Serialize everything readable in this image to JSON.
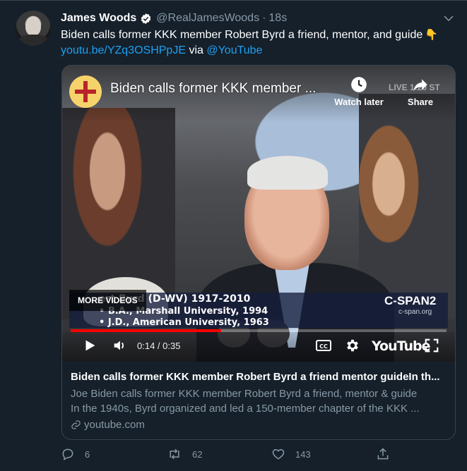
{
  "tweet": {
    "author_name": "James Woods",
    "author_handle": "@RealJamesWoods",
    "separator": "·",
    "time": "18s",
    "text": "Biden calls former KKK member Robert Byrd a friend, mentor, and guide",
    "emoji": "👇",
    "link_text": "youtu.be/YZq3OSHPpJE",
    "via_text": "via",
    "mention": "@YouTube"
  },
  "video": {
    "title": "Biden calls former KKK member ...",
    "watch_later_label": "Watch later",
    "share_label": "Share",
    "live_tag": "LIVE 1:20 ST",
    "lower_third": {
      "line1": "ert Byrd (D-WV) 1917-2010",
      "line2": "• B.A., Marshall University, 1994",
      "line3": "• J.D., American University, 1963",
      "network": "C-SPAN2",
      "network_url": "c-span.org"
    },
    "more_videos_label": "MORE VIDEOS",
    "timecode": "0:14 / 0:35",
    "progress": 0.4,
    "youtube_label": "YouTube"
  },
  "card": {
    "title": "Biden calls former KKK member Robert Byrd a friend mentor guideIn th...",
    "description_line1": "Joe Biden calls former KKK member Robert Byrd a friend, mentor & guide",
    "description_line2": "In the 1940s, Byrd organized and led a 150-member chapter of the KKK ...",
    "domain": "youtube.com"
  },
  "actions": {
    "reply_count": "6",
    "retweet_count": "62",
    "like_count": "143"
  },
  "colors": {
    "background": "#15202b",
    "accent": "#1da1f2",
    "muted": "#8899a6",
    "border": "#38444d",
    "progress": "#ff0000"
  },
  "icons": [
    "verified-badge-icon",
    "caret-down-icon",
    "clock-icon",
    "share-arrow-icon",
    "play-icon",
    "volume-icon",
    "cc-icon",
    "gear-icon",
    "fullscreen-icon",
    "link-icon",
    "reply-icon",
    "retweet-icon",
    "like-icon",
    "share-icon"
  ]
}
